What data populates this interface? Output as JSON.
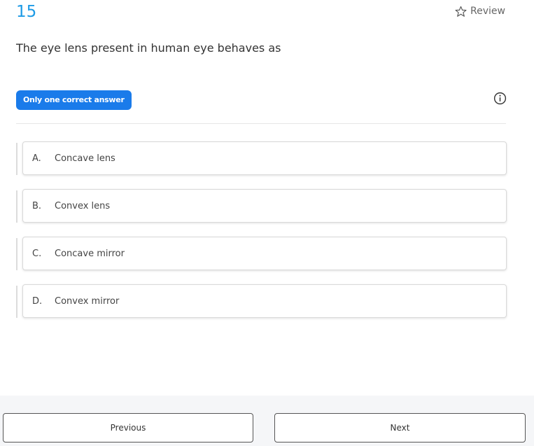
{
  "question": {
    "number": "15",
    "text": "The eye lens present in human eye behaves as",
    "answer_type": "Only one correct answer"
  },
  "review": {
    "label": "Review",
    "icon": "star-outline-icon"
  },
  "info": {
    "icon": "info-circle-icon"
  },
  "options": [
    {
      "letter": "A.",
      "text": "Concave lens"
    },
    {
      "letter": "B.",
      "text": "Convex lens"
    },
    {
      "letter": "C.",
      "text": "Concave mirror"
    },
    {
      "letter": "D.",
      "text": "Convex mirror"
    }
  ],
  "navigation": {
    "previous_label": "Previous",
    "next_label": "Next"
  },
  "colors": {
    "accent": "#1a7bea",
    "question_number": "#1e9be6",
    "footer_bg": "#f5f6f8"
  }
}
